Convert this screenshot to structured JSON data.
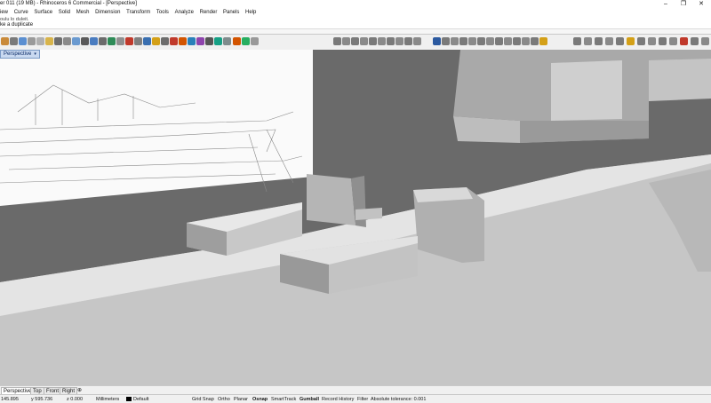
{
  "title": "er 011 (19 MB) - Rhinoceros 6 Commercial - [Perspective]",
  "window_controls": {
    "minimize": "–",
    "maximize": "❐",
    "close": "✕"
  },
  "menu": [
    "iew",
    "Curve",
    "Surface",
    "Solid",
    "Mesh",
    "Dimension",
    "Transform",
    "Tools",
    "Analyze",
    "Render",
    "Panels",
    "Help"
  ],
  "command": {
    "history": "oulu lo duleit.",
    "prompt": "ke a duplicate"
  },
  "viewport": {
    "tab_label": "Perspective",
    "tab_chevron": "▾"
  },
  "view_tabs": [
    "Perspective",
    "Top",
    "Front",
    "Right"
  ],
  "view_tabs_add": "⊕",
  "status": {
    "x": "145.895",
    "y": "y 595.736",
    "z": "z 0.000",
    "units": "Millimeters",
    "layer": "Default",
    "grid_snap": "Grid Snap",
    "ortho": "Ortho",
    "planar": "Planar",
    "osnap": "Osnap",
    "smarttrack": "SmartTrack",
    "gumball": "Gumball",
    "record_history": "Record History",
    "filter": "Filter",
    "tolerance": "Absolute tolerance: 0.001"
  },
  "colors": {
    "viewport_bg": "#6a6a6a",
    "model": "#d8d8d8",
    "tab_active": "#c9d9f0"
  }
}
